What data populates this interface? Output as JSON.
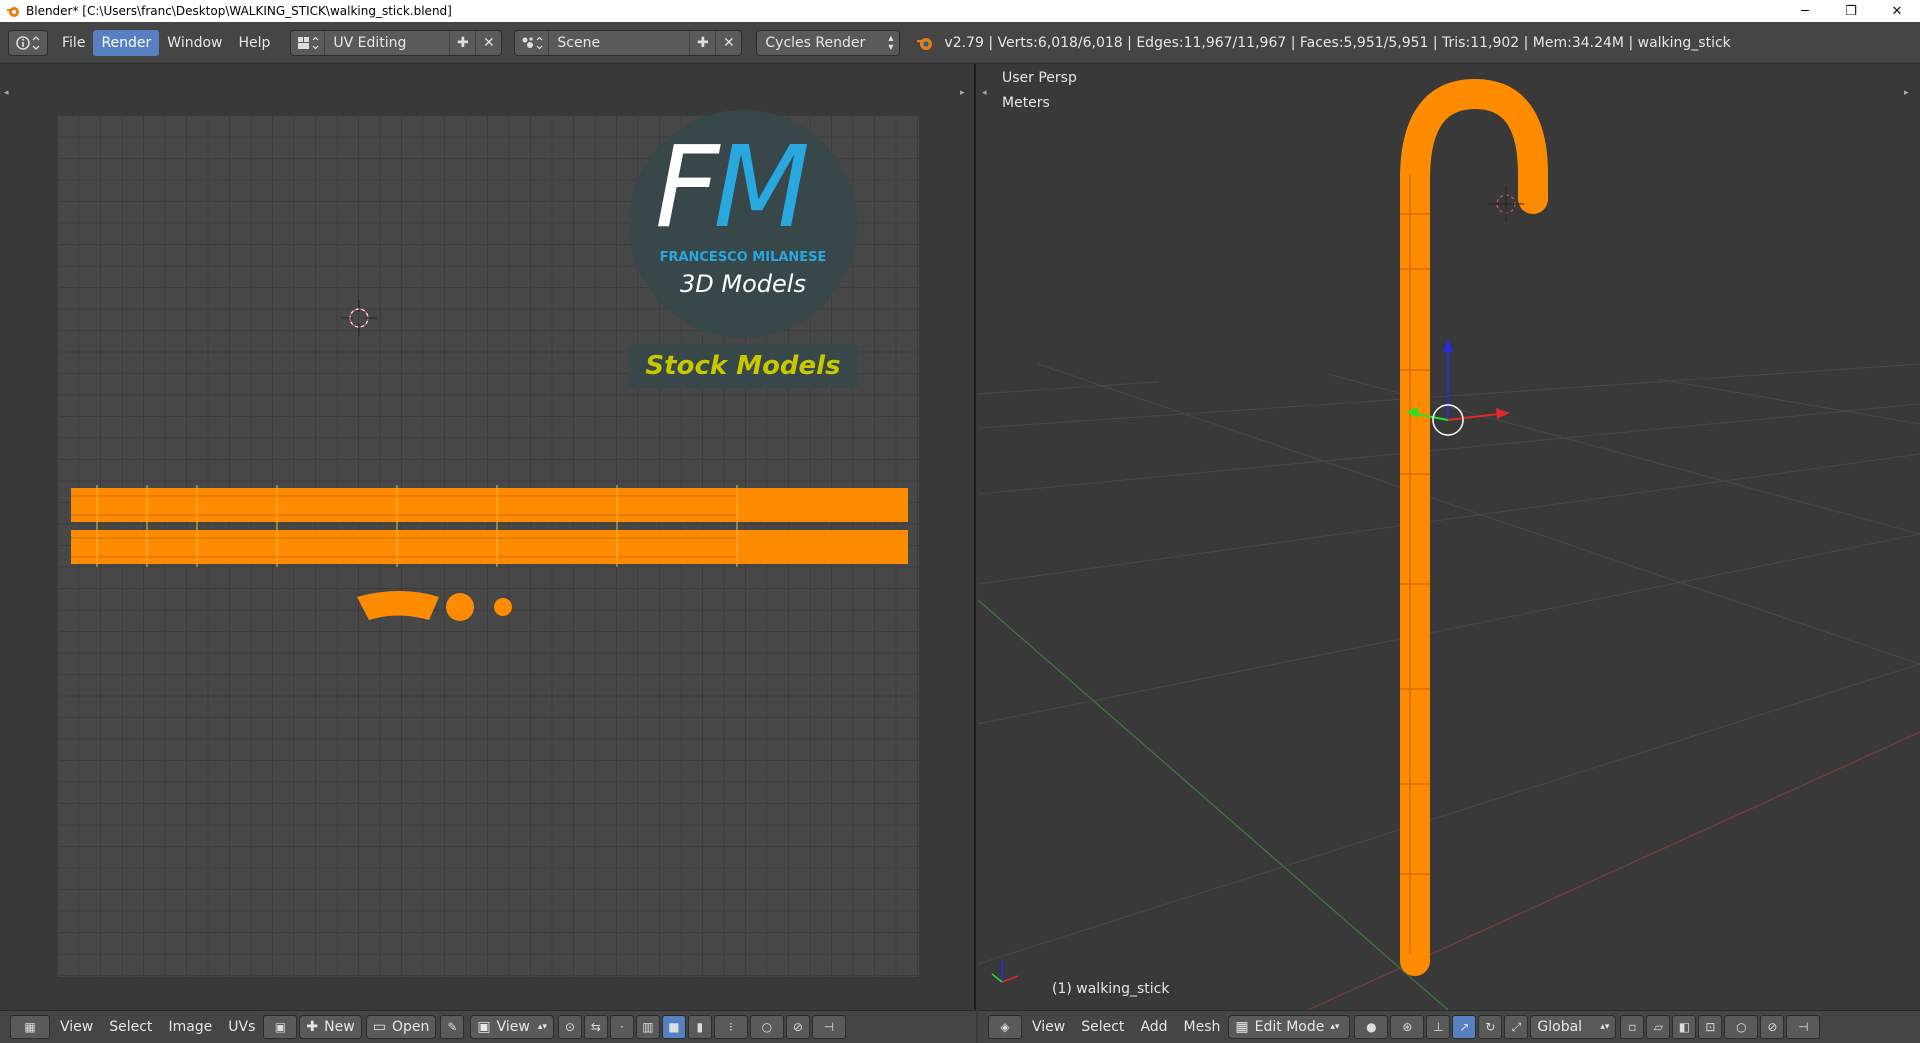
{
  "window": {
    "title": "Blender* [C:\\Users\\franc\\Desktop\\WALKING_STICK\\walking_stick.blend]",
    "minimize": "─",
    "restore": "❐",
    "close": "✕"
  },
  "info_header": {
    "menus": [
      "File",
      "Render",
      "Window",
      "Help"
    ],
    "active_menu": "Render",
    "screen_layout": "UV Editing",
    "scene": "Scene",
    "render_engine": "Cycles Render",
    "stats": "v2.79 | Verts:6,018/6,018 | Edges:11,967/11,967 | Faces:5,951/5,951 | Tris:11,902 | Mem:34.24M | walking_stick"
  },
  "image_editor": {
    "logo": {
      "initials_f": "F",
      "initials_m": "M",
      "name": "FRANCESCO MILANESE",
      "tagline": "3D Models",
      "badge": "Stock Models"
    },
    "footer": {
      "menus": [
        "View",
        "Select",
        "Image",
        "UVs"
      ],
      "new_label": "New",
      "open_label": "Open",
      "view_label": "View"
    }
  },
  "viewport": {
    "view_name": "User Persp",
    "units": "Meters",
    "object_label": "(1) walking_stick",
    "footer": {
      "menus": [
        "View",
        "Select",
        "Add",
        "Mesh"
      ],
      "mode": "Edit Mode",
      "orientation": "Global"
    }
  },
  "colors": {
    "accent": "#5680c2",
    "mesh_orange": "#ff8c00",
    "logo_blue": "#29a8e0",
    "badge_yellow": "#c8c800"
  }
}
